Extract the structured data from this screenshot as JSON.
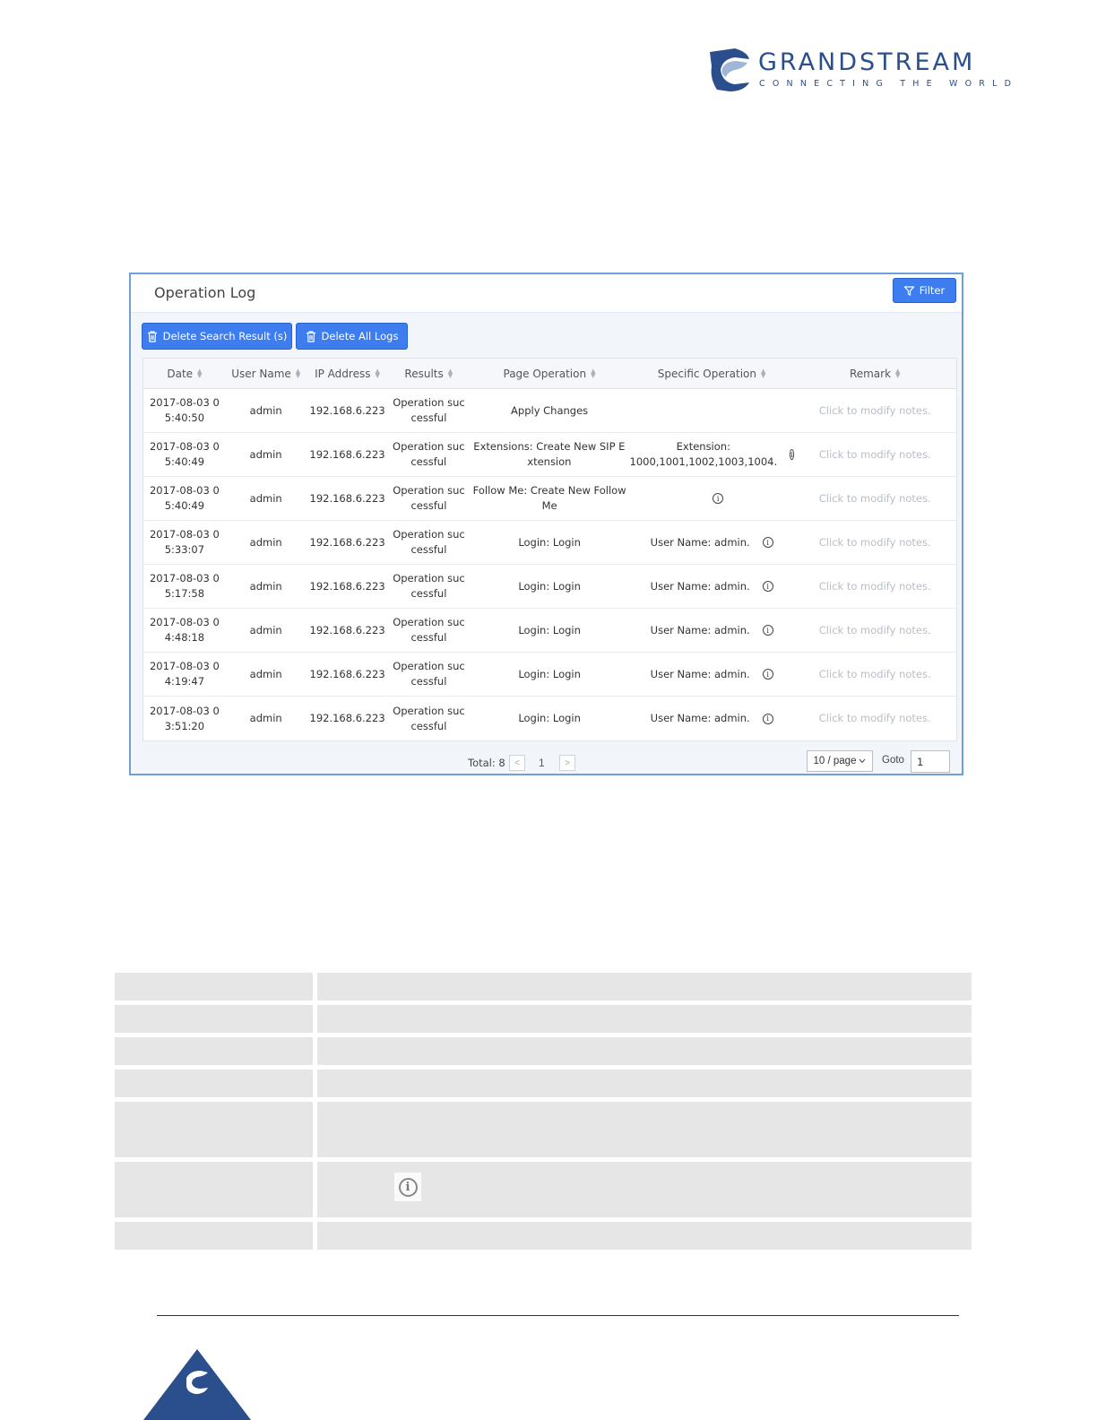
{
  "brand": {
    "name": "GRANDSTREAM",
    "tagline": "CONNECTING THE WORLD"
  },
  "panel": {
    "title": "Operation Log",
    "filter_label": "Filter",
    "delete_search_label": "Delete Search Result (s)",
    "delete_all_label": "Delete All Logs"
  },
  "table": {
    "headers": {
      "date": "Date",
      "user": "User Name",
      "ip": "IP Address",
      "results": "Results",
      "page_op": "Page Operation",
      "spec_op": "Specific Operation",
      "remark": "Remark"
    },
    "rows": [
      {
        "date": "2017-08-03 05:40:50",
        "user": "admin",
        "ip": "192.168.6.223",
        "result": "Operation successful",
        "page_op": "Apply Changes",
        "spec_op": "",
        "remark": "Click to modify notes."
      },
      {
        "date": "2017-08-03 05:40:49",
        "user": "admin",
        "ip": "192.168.6.223",
        "result": "Operation successful",
        "page_op": "Extensions: Create New SIP Extension",
        "spec_op": "Extension: 1000,1001,1002,1003,1004.",
        "remark": "Click to modify notes."
      },
      {
        "date": "2017-08-03 05:40:49",
        "user": "admin",
        "ip": "192.168.6.223",
        "result": "Operation successful",
        "page_op": "Follow Me: Create New Follow Me",
        "spec_op": "",
        "remark": "Click to modify notes."
      },
      {
        "date": "2017-08-03 05:33:07",
        "user": "admin",
        "ip": "192.168.6.223",
        "result": "Operation successful",
        "page_op": "Login: Login",
        "spec_op": "User Name: admin.",
        "remark": "Click to modify notes."
      },
      {
        "date": "2017-08-03 05:17:58",
        "user": "admin",
        "ip": "192.168.6.223",
        "result": "Operation successful",
        "page_op": "Login: Login",
        "spec_op": "User Name: admin.",
        "remark": "Click to modify notes."
      },
      {
        "date": "2017-08-03 04:48:18",
        "user": "admin",
        "ip": "192.168.6.223",
        "result": "Operation successful",
        "page_op": "Login: Login",
        "spec_op": "User Name: admin.",
        "remark": "Click to modify notes."
      },
      {
        "date": "2017-08-03 04:19:47",
        "user": "admin",
        "ip": "192.168.6.223",
        "result": "Operation successful",
        "page_op": "Login: Login",
        "spec_op": "User Name: admin.",
        "remark": "Click to modify notes."
      },
      {
        "date": "2017-08-03 03:51:20",
        "user": "admin",
        "ip": "192.168.6.223",
        "result": "Operation successful",
        "page_op": "Login: Login",
        "spec_op": "User Name: admin.",
        "remark": "Click to modify notes."
      }
    ]
  },
  "pagination": {
    "total": "Total: 8",
    "current_page": "1",
    "page_size": "10 / page",
    "goto_label": "Goto",
    "goto_value": "1"
  },
  "colors": {
    "accent": "#3d7df0",
    "brand": "#2b4f8c",
    "panel_border": "#6f9fd8"
  }
}
